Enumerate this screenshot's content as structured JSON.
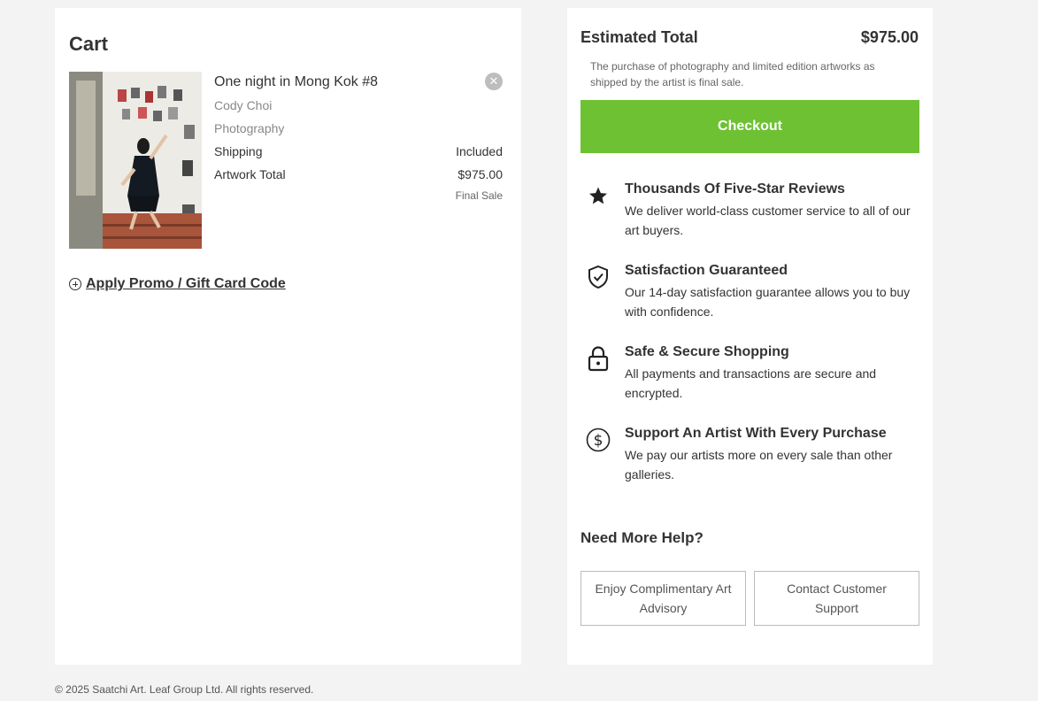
{
  "cart": {
    "title": "Cart",
    "item": {
      "title": "One night in Mong Kok #8",
      "artist": "Cody Choi",
      "category": "Photography",
      "shipping_label": "Shipping",
      "shipping_value": "Included",
      "total_label": "Artwork Total",
      "total_value": "$975.00",
      "final_sale": "Final Sale",
      "remove_glyph": "✕"
    },
    "promo_label": "Apply Promo / Gift Card Code"
  },
  "summary": {
    "estimated_label": "Estimated Total",
    "estimated_value": "$975.00",
    "disclaimer": "The purchase of photography and limited edition artworks as shipped by the artist is final sale.",
    "checkout_label": "Checkout",
    "checkout_color": "#6ec133",
    "features": [
      {
        "icon": "star-icon",
        "title": "Thousands Of Five-Star Reviews",
        "desc": "We deliver world-class customer service to all of our art buyers."
      },
      {
        "icon": "shield-check-icon",
        "title": "Satisfaction Guaranteed",
        "desc": "Our 14-day satisfaction guarantee allows you to buy with confidence."
      },
      {
        "icon": "lock-icon",
        "title": "Safe & Secure Shopping",
        "desc": "All payments and transactions are secure and encrypted."
      },
      {
        "icon": "dollar-circle-icon",
        "title": "Support An Artist With Every Purchase",
        "desc": "We pay our artists more on every sale than other galleries."
      }
    ],
    "help_title": "Need More Help?",
    "help_buttons": [
      "Enjoy Complimentary Art Advisory",
      "Contact Customer Support"
    ]
  },
  "footer": "© 2025 Saatchi Art. Leaf Group Ltd. All rights reserved."
}
